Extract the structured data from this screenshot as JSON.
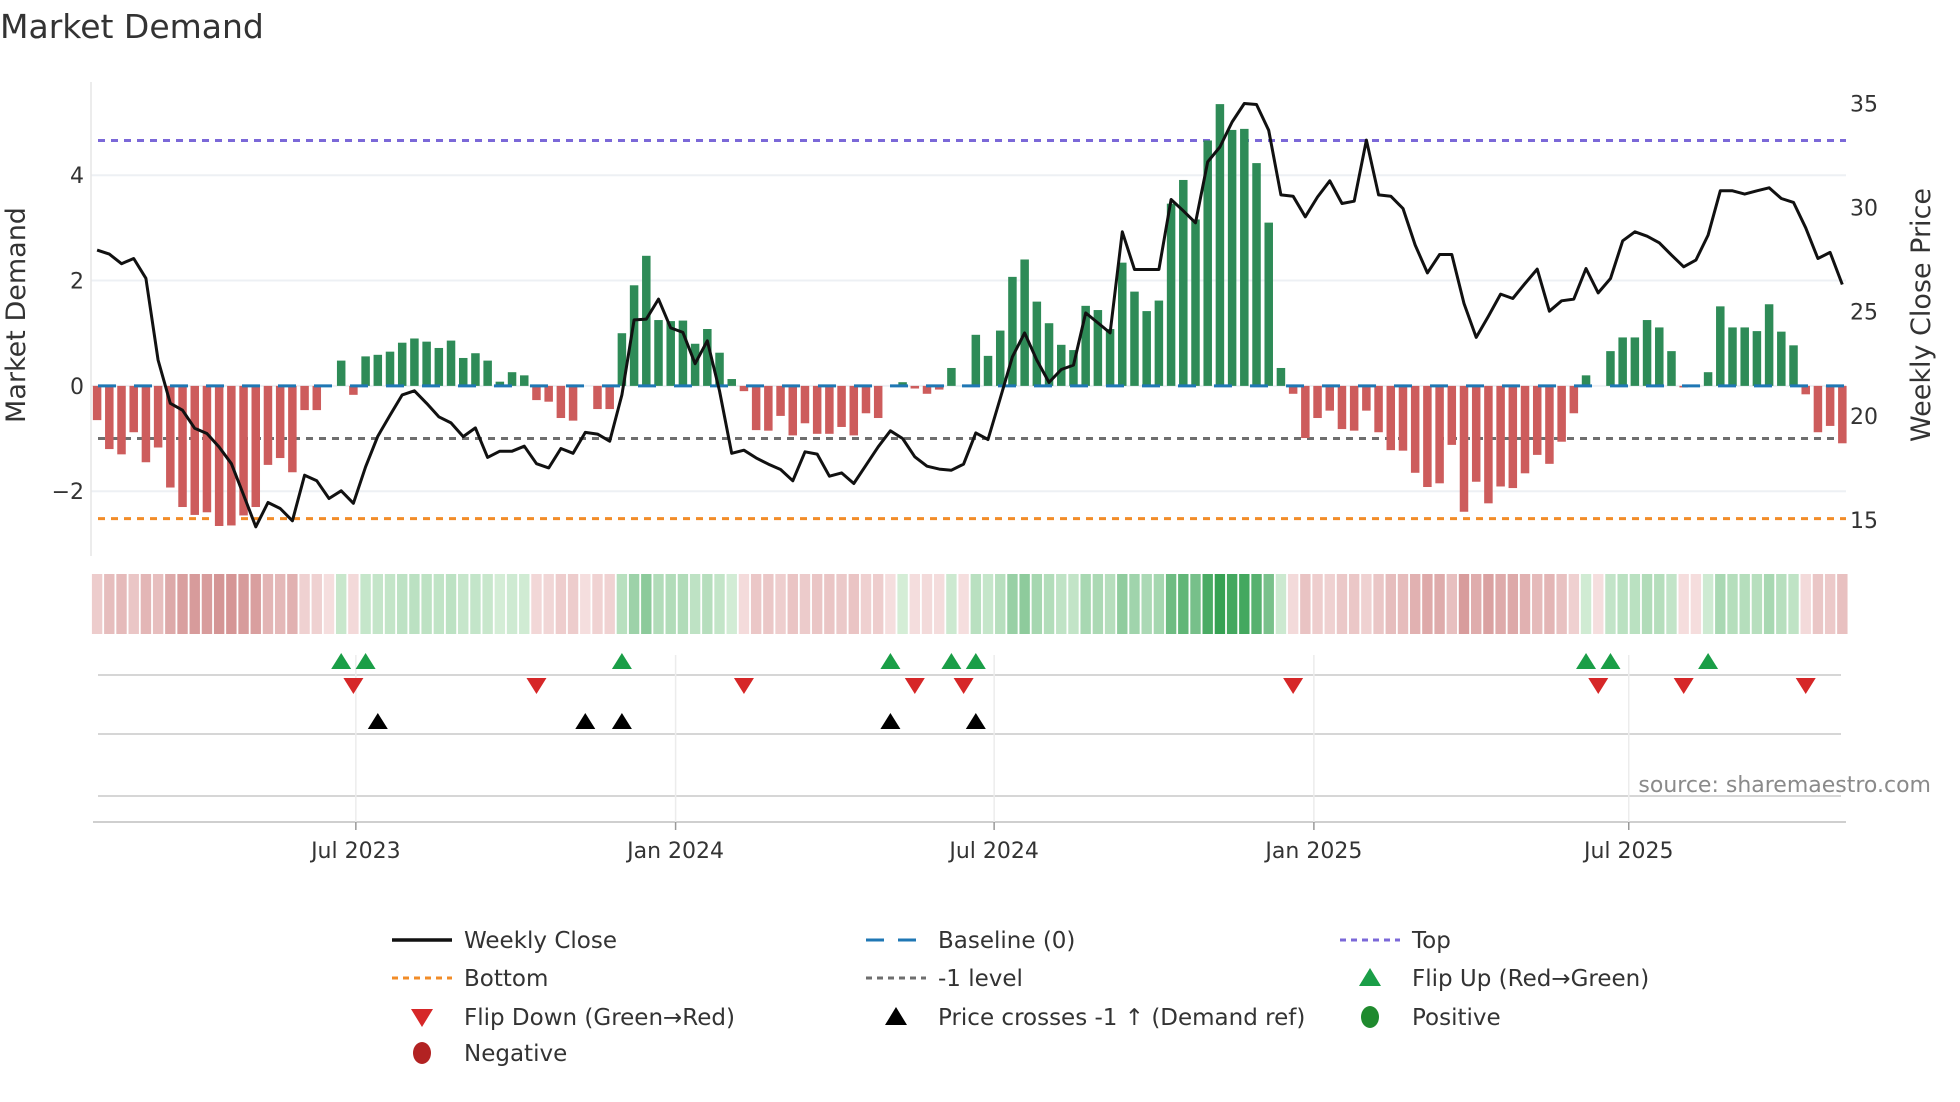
{
  "chart_data": {
    "type": "bar",
    "title": "Market Demand",
    "ylabel": "Market Demand",
    "y2label": "Weekly Close Price",
    "source": "source: sharemaestro.com",
    "x_unit": "week index",
    "xlim": [
      -0.5,
      143.3
    ],
    "ylim": [
      -3.23,
      5.77
    ],
    "y2lim": [
      13.27,
      36.02
    ],
    "yticks": [
      {
        "value": 4,
        "label": "4"
      },
      {
        "value": 2,
        "label": "2"
      },
      {
        "value": 0,
        "label": "0"
      },
      {
        "value": -2,
        "label": "−2"
      }
    ],
    "y2ticks": [
      {
        "value": 35,
        "label": "35"
      },
      {
        "value": 30,
        "label": "30"
      },
      {
        "value": 25,
        "label": "25"
      },
      {
        "value": 20,
        "label": "20"
      },
      {
        "value": 15,
        "label": "15"
      }
    ],
    "xticks": [
      {
        "value": 21.2,
        "label": "Jul 2023"
      },
      {
        "value": 47.4,
        "label": "Jan 2024"
      },
      {
        "value": 73.5,
        "label": "Jul 2024"
      },
      {
        "value": 99.7,
        "label": "Jan 2025"
      },
      {
        "value": 125.5,
        "label": "Jul 2025"
      }
    ],
    "levels": {
      "top": 4.66,
      "bottom": -2.52,
      "minus_one": -1,
      "baseline": 0
    },
    "demand": [
      -0.65,
      -1.2,
      -1.3,
      -0.88,
      -1.45,
      -1.17,
      -1.93,
      -2.3,
      -2.45,
      -2.4,
      -2.66,
      -2.65,
      -2.46,
      -2.3,
      -1.5,
      -1.37,
      -1.64,
      -0.46,
      -0.46,
      0,
      0.48,
      -0.17,
      0.56,
      0.59,
      0.65,
      0.82,
      0.9,
      0.84,
      0.72,
      0.86,
      0.53,
      0.62,
      0.48,
      0.08,
      0.26,
      0.2,
      -0.27,
      -0.3,
      -0.61,
      -0.66,
      0,
      -0.44,
      -0.44,
      1.0,
      1.91,
      2.47,
      1.25,
      1.23,
      1.24,
      0.8,
      1.08,
      0.63,
      0.13,
      -0.1,
      -0.84,
      -0.85,
      -0.57,
      -0.94,
      -0.71,
      -0.91,
      -0.91,
      -0.78,
      -0.94,
      -0.52,
      -0.61,
      0,
      0.07,
      -0.05,
      -0.15,
      -0.07,
      0.34,
      0,
      0.97,
      0.57,
      1.05,
      2.07,
      2.4,
      1.6,
      1.19,
      0.78,
      0.68,
      1.52,
      1.44,
      1.08,
      2.34,
      1.79,
      1.42,
      1.62,
      3.46,
      3.91,
      3.16,
      4.66,
      5.35,
      4.86,
      4.88,
      4.23,
      3.1,
      0.34,
      -0.15,
      -0.99,
      -0.61,
      -0.47,
      -0.82,
      -0.85,
      -0.47,
      -0.88,
      -1.22,
      -1.23,
      -1.65,
      -1.92,
      -1.85,
      -1.12,
      -2.39,
      -1.82,
      -2.23,
      -1.91,
      -1.94,
      -1.66,
      -1.31,
      -1.48,
      -1.06,
      -0.52,
      0.2,
      0,
      0.66,
      0.92,
      0.92,
      1.25,
      1.11,
      0.66,
      -0.03,
      -0.02,
      0.26,
      1.51,
      1.11,
      1.11,
      1.04,
      1.55,
      1.03,
      0.77,
      -0.16,
      -0.88,
      -0.76,
      -1.09
    ],
    "close": [
      27.95,
      27.76,
      27.3,
      27.55,
      26.6,
      22.67,
      20.6,
      20.27,
      19.4,
      19.15,
      18.5,
      17.7,
      16.2,
      14.67,
      15.84,
      15.55,
      14.96,
      17.15,
      16.88,
      16.03,
      16.4,
      15.8,
      17.55,
      19.02,
      20.03,
      21.0,
      21.2,
      20.6,
      19.95,
      19.66,
      19.0,
      19.42,
      18.0,
      18.3,
      18.3,
      18.54,
      17.7,
      17.5,
      18.43,
      18.2,
      19.2,
      19.12,
      18.78,
      21.0,
      24.6,
      24.64,
      25.6,
      24.22,
      24.0,
      22.5,
      23.6,
      21.2,
      18.2,
      18.35,
      17.98,
      17.68,
      17.42,
      16.88,
      18.27,
      18.16,
      17.1,
      17.26,
      16.75,
      17.63,
      18.51,
      19.28,
      18.91,
      18.03,
      17.58,
      17.44,
      17.39,
      17.68,
      19.18,
      18.86,
      20.83,
      22.83,
      23.98,
      22.67,
      21.6,
      22.22,
      22.43,
      24.94,
      24.46,
      23.98,
      28.83,
      27.02,
      27.02,
      27.02,
      30.38,
      29.84,
      29.26,
      32.19,
      32.9,
      34.1,
      34.99,
      34.94,
      33.7,
      30.6,
      30.54,
      29.55,
      30.5,
      31.28,
      30.19,
      30.3,
      33.23,
      30.6,
      30.54,
      29.95,
      28.19,
      26.86,
      27.74,
      27.74,
      25.39,
      23.76,
      24.78,
      25.84,
      25.63,
      26.35,
      27.04,
      25.02,
      25.52,
      25.6,
      27.07,
      25.9,
      26.59,
      28.4,
      28.83,
      28.62,
      28.3,
      27.71,
      27.15,
      27.47,
      28.67,
      30.8,
      30.8,
      30.64,
      30.8,
      30.94,
      30.43,
      30.24,
      29.02,
      27.55,
      27.84,
      26.3
    ],
    "flip_up": [
      20,
      22,
      43,
      65,
      70,
      72,
      122,
      124,
      132
    ],
    "flip_down": [
      21,
      36,
      53,
      67,
      71,
      98,
      123,
      130,
      140
    ],
    "price_cross_up": [
      23,
      40,
      43,
      65,
      72
    ],
    "legend": [
      {
        "label": "Weekly Close",
        "symbol": "line"
      },
      {
        "label": "Baseline (0)",
        "symbol": "dash"
      },
      {
        "label": "Top",
        "symbol": "dot-purple"
      },
      {
        "label": "Bottom",
        "symbol": "dot-orange"
      },
      {
        "label": "-1 level",
        "symbol": "dot-grey"
      },
      {
        "label": "Flip Up (Red→Green)",
        "symbol": "triangle-up-green"
      },
      {
        "label": "Flip Down (Green→Red)",
        "symbol": "triangle-down-red"
      },
      {
        "label": "Price crosses -1 ↑ (Demand ref)",
        "symbol": "triangle-up-black"
      },
      {
        "label": "Positive",
        "symbol": "circle-green"
      },
      {
        "label": "Negative",
        "symbol": "circle-red"
      }
    ],
    "legend_placement": "bottom"
  },
  "colors": {
    "positive": "#2e8b57",
    "negative": "#cd5c5c",
    "close": "#111111",
    "top": "#7b68d8",
    "bottom": "#f28c28",
    "minus_one": "#6e6e6e",
    "baseline": "#1f77b4",
    "flip_up": "#1a9e47",
    "flip_down": "#d62728",
    "cross": "#000000",
    "legend_positive": "#1f8a2e",
    "legend_negative": "#b22222"
  }
}
